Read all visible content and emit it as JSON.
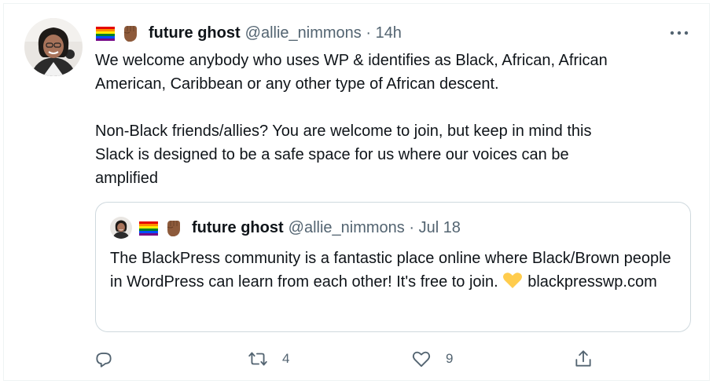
{
  "tweet": {
    "author_name": "future ghost",
    "handle_time": "@allie_nimmons · 14h",
    "body": "We welcome anybody who uses WP & identifies as Black, African, African\nAmerican, Caribbean or any other type of African descent.\n\nNon-Black friends/allies? You are welcome to join, but keep in mind this\nSlack is designed to be a safe space for us where our voices can be\namplified",
    "emojis": [
      "rainbow-flag-icon",
      "raised-fist-icon"
    ]
  },
  "quoted": {
    "author_name": "future ghost",
    "handle_time": "@allie_nimmons · Jul 18",
    "text_before": "The BlackPress community is a fantastic place online where Black/Brown people in WordPress can learn from each other! It's free to join.",
    "link": "blackpresswp.com"
  },
  "actions": {
    "retweets": "4",
    "likes": "9"
  },
  "colors": {
    "text": "#0f1419",
    "secondary": "#536471",
    "border": "#cfd9de",
    "fist": "#8d5a3b",
    "yellow_heart": "#ffcc4d"
  }
}
